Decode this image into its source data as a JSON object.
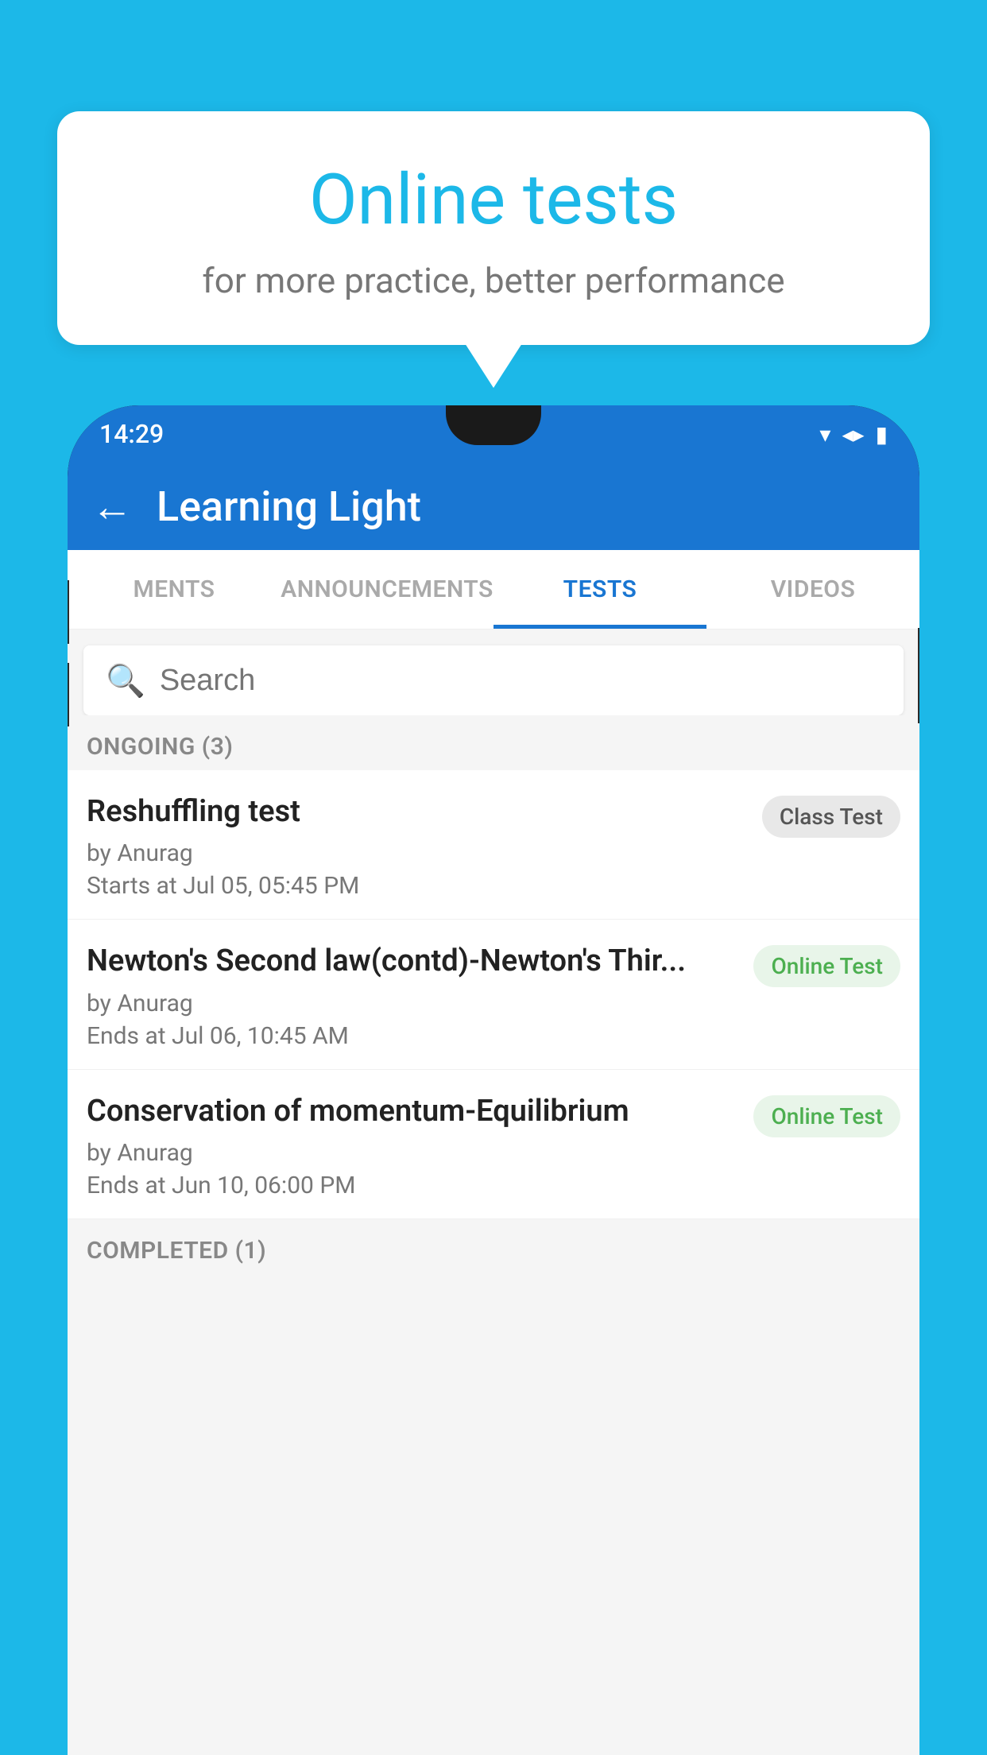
{
  "background_color": "#1cb8e8",
  "speech_bubble": {
    "title": "Online tests",
    "subtitle": "for more practice, better performance"
  },
  "status_bar": {
    "time": "14:29",
    "wifi_icon": "▼",
    "signal_icon": "▲",
    "battery_icon": "▮"
  },
  "app_bar": {
    "back_icon": "←",
    "title": "Learning Light"
  },
  "tabs": [
    {
      "label": "MENTS",
      "active": false
    },
    {
      "label": "ANNOUNCEMENTS",
      "active": false
    },
    {
      "label": "TESTS",
      "active": true
    },
    {
      "label": "VIDEOS",
      "active": false
    }
  ],
  "search": {
    "placeholder": "Search",
    "icon": "🔍"
  },
  "sections": {
    "ongoing": {
      "label": "ONGOING (3)",
      "tests": [
        {
          "title": "Reshuffling test",
          "author": "by Anurag",
          "date": "Starts at  Jul 05, 05:45 PM",
          "badge": "Class Test",
          "badge_type": "class"
        },
        {
          "title": "Newton's Second law(contd)-Newton's Thir...",
          "author": "by Anurag",
          "date": "Ends at  Jul 06, 10:45 AM",
          "badge": "Online Test",
          "badge_type": "online"
        },
        {
          "title": "Conservation of momentum-Equilibrium",
          "author": "by Anurag",
          "date": "Ends at  Jun 10, 06:00 PM",
          "badge": "Online Test",
          "badge_type": "online"
        }
      ]
    },
    "completed": {
      "label": "COMPLETED (1)"
    }
  }
}
